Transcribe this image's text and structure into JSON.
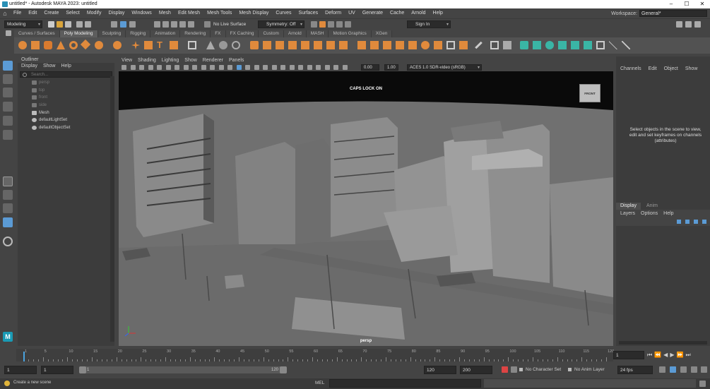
{
  "window": {
    "title": "untitled* - Autodesk MAYA 2023: untitled",
    "controls": [
      "–",
      "☐",
      "✕"
    ]
  },
  "menus": [
    "File",
    "Edit",
    "Create",
    "Select",
    "Modify",
    "Display",
    "Windows",
    "Mesh",
    "Edit Mesh",
    "Mesh Tools",
    "Mesh Display",
    "Curves",
    "Surfaces",
    "Deform",
    "UV",
    "Generate",
    "Cache",
    "Arnold",
    "Help"
  ],
  "workspace": {
    "label": "Workspace:",
    "value": "General*"
  },
  "statusline": {
    "menuset": "Modeling",
    "live_surface": "No Live Surface",
    "symmetry": "Symmetry: Off",
    "sign_in": "Sign In"
  },
  "shelf_tabs": [
    "Curves / Surfaces",
    "Poly Modeling",
    "Sculpting",
    "Rigging",
    "Animation",
    "Rendering",
    "FX",
    "FX Caching",
    "Custom",
    "Arnold",
    "MASH",
    "Motion Graphics",
    "XGen"
  ],
  "active_shelf_tab": "Poly Modeling",
  "outliner": {
    "title": "Outliner",
    "menus": [
      "Display",
      "Show",
      "Help"
    ],
    "search_placeholder": "Search...",
    "items": [
      {
        "label": "persp",
        "kind": "camera",
        "dim": true
      },
      {
        "label": "top",
        "kind": "camera",
        "dim": true
      },
      {
        "label": "front",
        "kind": "camera",
        "dim": true
      },
      {
        "label": "side",
        "kind": "camera",
        "dim": true
      },
      {
        "label": "Mesh",
        "kind": "mesh",
        "dim": false
      },
      {
        "label": "defaultLightSet",
        "kind": "set",
        "dim": false
      },
      {
        "label": "defaultObjectSet",
        "kind": "set",
        "dim": false
      }
    ]
  },
  "viewport": {
    "menus": [
      "View",
      "Shading",
      "Lighting",
      "Show",
      "Renderer",
      "Panels"
    ],
    "value_a": "0.00",
    "value_b": "1.00",
    "color_space": "ACES 1.0 SDR-video (sRGB)",
    "hud_message": "CAPS LOCK ON",
    "camera_name": "persp",
    "viewcube_label": "FRONT"
  },
  "channel_box": {
    "menus": [
      "Channels",
      "Edit",
      "Object",
      "Show"
    ],
    "hint": "Select objects in the scene to view, edit and set keyframes on channels (attributes)"
  },
  "layer_editor": {
    "tabs": [
      "Display",
      "Anim"
    ],
    "active_tab": "Display",
    "menus": [
      "Layers",
      "Options",
      "Help"
    ]
  },
  "time_slider": {
    "ticks": [
      "1",
      "5",
      "10",
      "15",
      "20",
      "25",
      "30",
      "35",
      "40",
      "45",
      "50",
      "55",
      "60",
      "65",
      "70",
      "75",
      "80",
      "85",
      "90",
      "95",
      "100",
      "105",
      "110",
      "115",
      "120"
    ],
    "current_frame": "1"
  },
  "range": {
    "start": "1",
    "playback_start": "1",
    "slider_start": "1",
    "slider_end": "120",
    "playback_end": "120",
    "end": "200",
    "character_set": "No Character Set",
    "anim_layer": "No Anim Layer",
    "fps": "24 fps"
  },
  "command_line": {
    "language": "MEL",
    "help_text": "Create a new scene"
  },
  "colors": {
    "accent": "#5b9bd5",
    "shelf_orange": "#e08a3c",
    "maya_teal": "#1a9bb5",
    "viewport_bg": "#707070"
  }
}
